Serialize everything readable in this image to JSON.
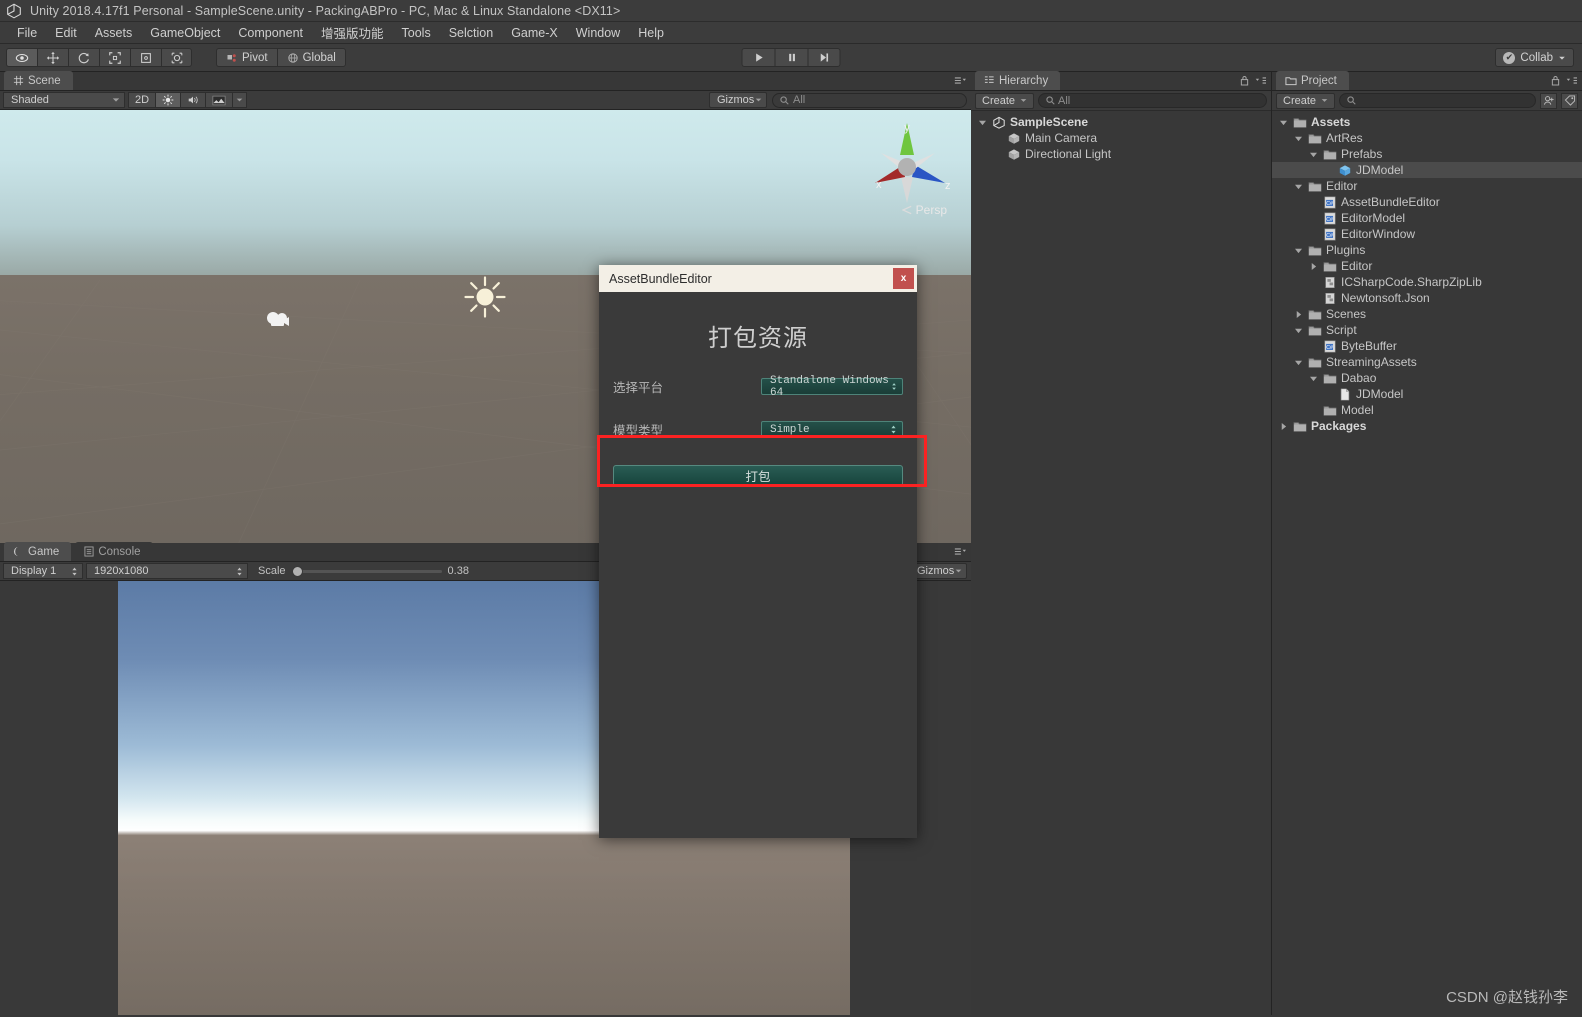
{
  "titlebar": {
    "title": "Unity 2018.4.17f1 Personal - SampleScene.unity - PackingABPro - PC, Mac & Linux Standalone <DX11>",
    "logo_icon": "unity-logo-icon"
  },
  "menubar": {
    "items": [
      {
        "label": "File"
      },
      {
        "label": "Edit"
      },
      {
        "label": "Assets"
      },
      {
        "label": "GameObject"
      },
      {
        "label": "Component"
      },
      {
        "label": "增强版功能"
      },
      {
        "label": "Tools"
      },
      {
        "label": "Selction"
      },
      {
        "label": "Game-X"
      },
      {
        "label": "Window"
      },
      {
        "label": "Help"
      }
    ]
  },
  "toolbar": {
    "tools": [
      {
        "name": "hand-tool",
        "icon": "hand-icon",
        "active": true
      },
      {
        "name": "move-tool",
        "icon": "move-arrows-icon",
        "active": false
      },
      {
        "name": "rotate-tool",
        "icon": "rotate-icon",
        "active": false
      },
      {
        "name": "scale-tool",
        "icon": "scale-icon",
        "active": false
      },
      {
        "name": "rect-tool",
        "icon": "rect-transform-icon",
        "active": false
      },
      {
        "name": "transform-tool",
        "icon": "transform-icon",
        "active": false
      }
    ],
    "pivot_label": "Pivot",
    "global_label": "Global",
    "play_label": "Play",
    "pause_label": "Pause",
    "step_label": "Step",
    "collab_label": "Collab"
  },
  "scene": {
    "tab_label": "Scene",
    "tab_icon": "scene-grid-icon",
    "draw_mode": "Shaded",
    "mode_2d": "2D",
    "lighting_icon": "lighting-sun-icon",
    "audio_icon": "audio-speaker-icon",
    "effects_icon": "effects-image-icon",
    "gizmos_label": "Gizmos",
    "search_placeholder": "All",
    "search_value": "",
    "persp_label": "Persp",
    "axis_x": "x",
    "axis_y": "y",
    "axis_z": "z"
  },
  "game": {
    "tab_label": "Game",
    "tab_icon": "game-controller-icon",
    "console_tab_label": "Console",
    "console_tab_icon": "console-list-icon",
    "display": "Display 1",
    "resolution": "1920x1080",
    "scale_label": "Scale",
    "scale_value": "0.38",
    "gizmos_label": "Gizmos"
  },
  "hierarchy": {
    "tab_label": "Hierarchy",
    "tab_icon": "hierarchy-icon",
    "create_label": "Create",
    "search_placeholder": "All",
    "items": [
      {
        "label": "SampleScene",
        "depth": 0,
        "arrow": "down",
        "icon": "unity-scene-icon",
        "bold": true,
        "selected": false
      },
      {
        "label": "Main Camera",
        "depth": 1,
        "arrow": "none",
        "icon": "gameobject-cube-icon",
        "bold": false,
        "selected": false
      },
      {
        "label": "Directional Light",
        "depth": 1,
        "arrow": "none",
        "icon": "gameobject-cube-icon",
        "bold": false,
        "selected": false
      }
    ]
  },
  "project": {
    "tab_label": "Project",
    "tab_icon": "project-folder-icon",
    "create_label": "Create",
    "search_placeholder": "",
    "items": [
      {
        "label": "Assets",
        "depth": 0,
        "arrow": "down",
        "icon": "folder-icon",
        "bold": true,
        "selected": false
      },
      {
        "label": "ArtRes",
        "depth": 1,
        "arrow": "down",
        "icon": "folder-icon",
        "bold": false,
        "selected": false
      },
      {
        "label": "Prefabs",
        "depth": 2,
        "arrow": "down",
        "icon": "folder-icon",
        "bold": false,
        "selected": false
      },
      {
        "label": "JDModel",
        "depth": 3,
        "arrow": "none",
        "icon": "prefab-cube-icon",
        "bold": false,
        "selected": true
      },
      {
        "label": "Editor",
        "depth": 1,
        "arrow": "down",
        "icon": "folder-icon",
        "bold": false,
        "selected": false
      },
      {
        "label": "AssetBundleEditor",
        "depth": 2,
        "arrow": "none",
        "icon": "csharp-script-icon",
        "bold": false,
        "selected": false
      },
      {
        "label": "EditorModel",
        "depth": 2,
        "arrow": "none",
        "icon": "csharp-script-icon",
        "bold": false,
        "selected": false
      },
      {
        "label": "EditorWindow",
        "depth": 2,
        "arrow": "none",
        "icon": "csharp-script-icon",
        "bold": false,
        "selected": false
      },
      {
        "label": "Plugins",
        "depth": 1,
        "arrow": "down",
        "icon": "folder-icon",
        "bold": false,
        "selected": false
      },
      {
        "label": "Editor",
        "depth": 2,
        "arrow": "right",
        "icon": "folder-icon",
        "bold": false,
        "selected": false
      },
      {
        "label": "ICSharpCode.SharpZipLib",
        "depth": 2,
        "arrow": "none",
        "icon": "dll-icon",
        "bold": false,
        "selected": false
      },
      {
        "label": "Newtonsoft.Json",
        "depth": 2,
        "arrow": "none",
        "icon": "dll-icon",
        "bold": false,
        "selected": false
      },
      {
        "label": "Scenes",
        "depth": 1,
        "arrow": "right",
        "icon": "folder-icon",
        "bold": false,
        "selected": false
      },
      {
        "label": "Script",
        "depth": 1,
        "arrow": "down",
        "icon": "folder-icon",
        "bold": false,
        "selected": false
      },
      {
        "label": "ByteBuffer",
        "depth": 2,
        "arrow": "none",
        "icon": "csharp-script-icon",
        "bold": false,
        "selected": false
      },
      {
        "label": "StreamingAssets",
        "depth": 1,
        "arrow": "down",
        "icon": "folder-icon",
        "bold": false,
        "selected": false
      },
      {
        "label": "Dabao",
        "depth": 2,
        "arrow": "down",
        "icon": "folder-icon",
        "bold": false,
        "selected": false
      },
      {
        "label": "JDModel",
        "depth": 3,
        "arrow": "none",
        "icon": "file-icon",
        "bold": false,
        "selected": false
      },
      {
        "label": "Model",
        "depth": 2,
        "arrow": "none",
        "icon": "folder-icon",
        "bold": false,
        "selected": false
      },
      {
        "label": "Packages",
        "depth": 0,
        "arrow": "right",
        "icon": "folder-icon",
        "bold": true,
        "selected": false
      }
    ]
  },
  "dialog": {
    "title": "AssetBundleEditor",
    "close_label": "x",
    "heading": "打包资源",
    "platform_label": "选择平台",
    "platform_value": "Standalone Windows 64",
    "model_label": "模型类型",
    "model_value": "Simple",
    "pack_button_label": "打包"
  },
  "annotation": {
    "highlight_color": "#fb2222"
  },
  "watermark": {
    "text": "CSDN @赵钱孙李"
  }
}
